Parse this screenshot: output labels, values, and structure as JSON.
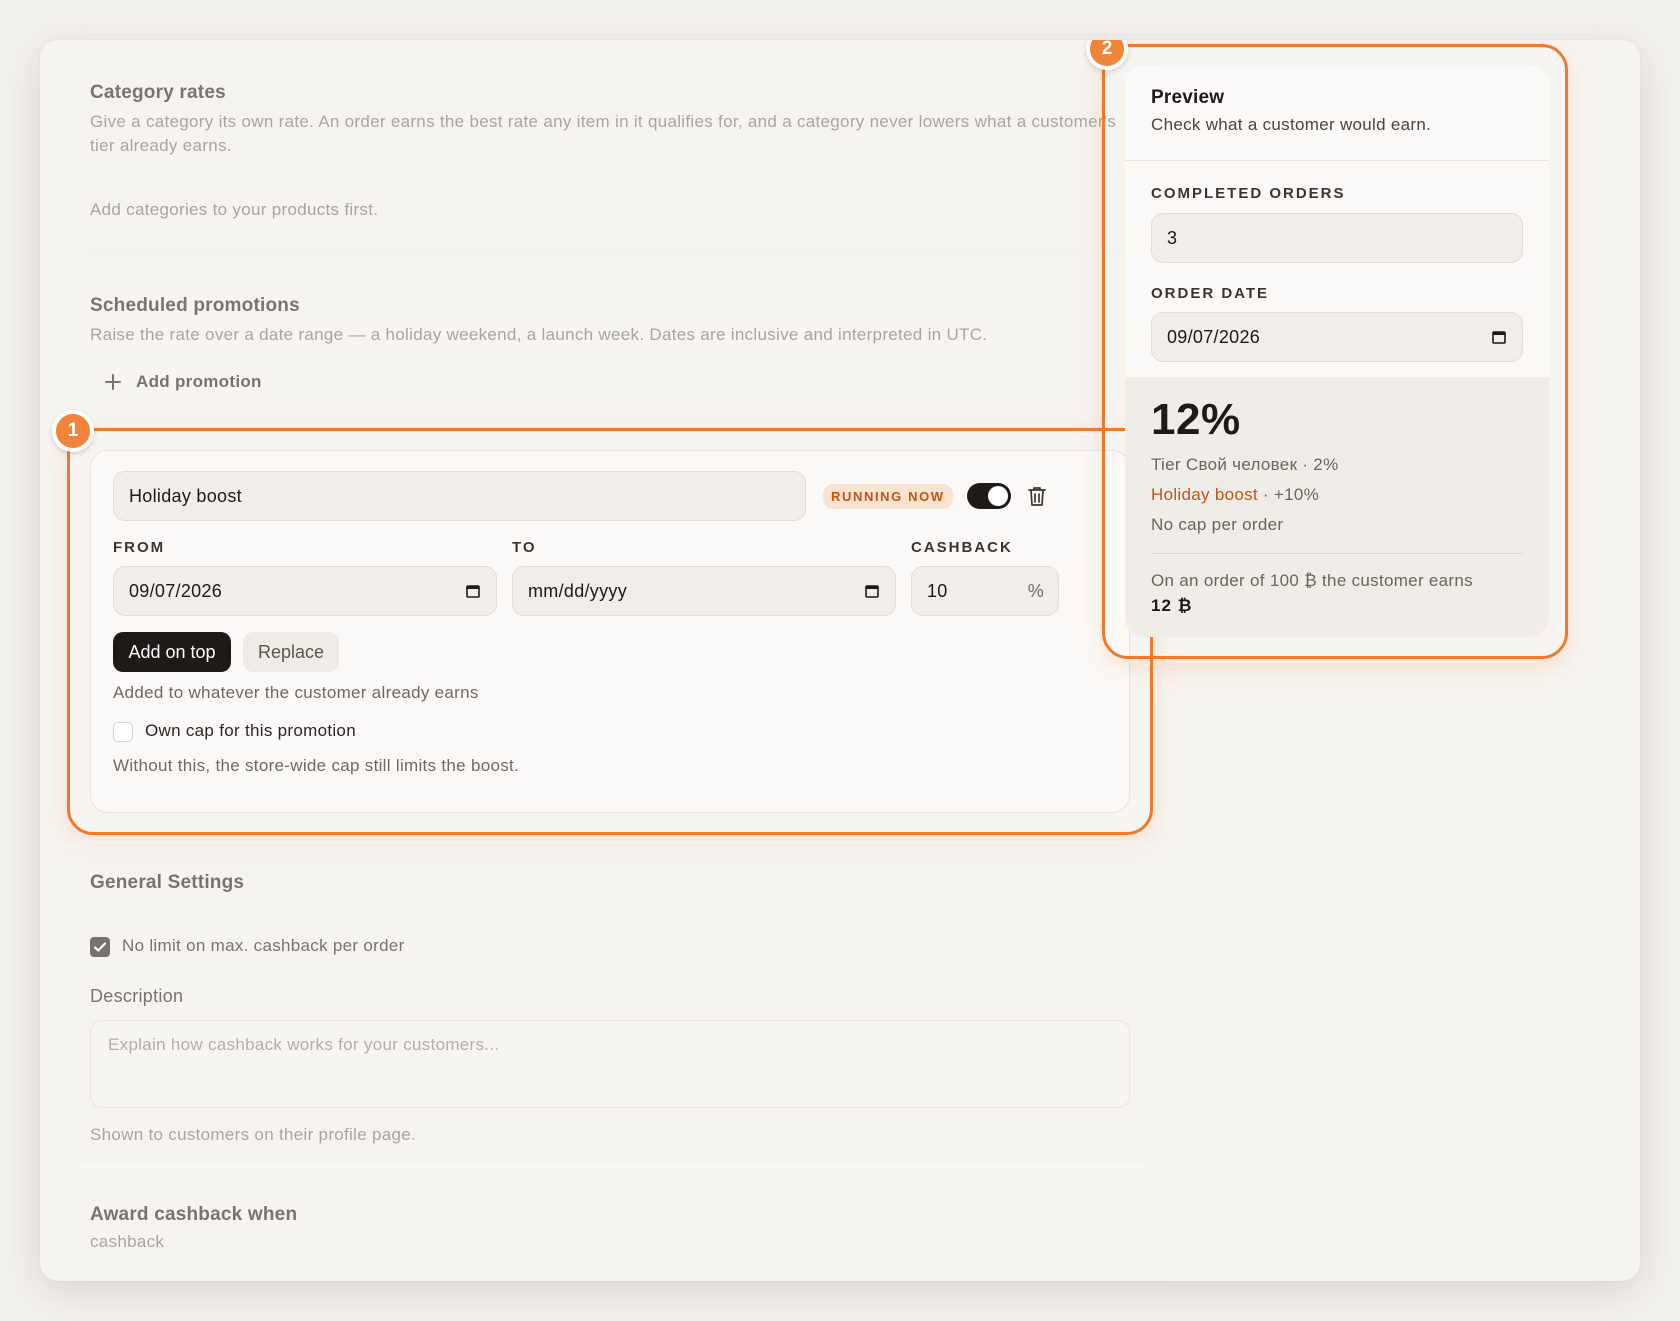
{
  "category_rates": {
    "title": "Category rates",
    "description": "Give a category its own rate. An order earns the best rate any item in it qualifies for, and a category never lowers what a customer's tier already earns.",
    "empty_note": "Add categories to your products first."
  },
  "scheduled_promotions": {
    "title": "Scheduled promotions",
    "description": "Raise the rate over a date range — a holiday weekend, a launch week. Dates are inclusive and interpreted in UTC.",
    "add_label": "Add promotion",
    "badge": "1"
  },
  "promotion": {
    "name": "Holiday boost",
    "status": "RUNNING NOW",
    "enabled": true,
    "from_label": "FROM",
    "from_value": "09/07/2026",
    "to_label": "TO",
    "to_value": "mm/dd/yyyy",
    "cashback_label": "CASHBACK",
    "cashback_value": "10",
    "cashback_unit": "%",
    "mode_active": "Add on top",
    "mode_other": "Replace",
    "mode_hint": "Added to whatever the customer already earns",
    "own_cap_label": "Own cap for this promotion",
    "own_cap_checked": false,
    "cap_hint": "Without this, the store-wide cap still limits the boost."
  },
  "general_settings": {
    "title": "General Settings",
    "no_limit_label": "No limit on max. cashback per order",
    "no_limit_checked": true,
    "description_label": "Description",
    "description_placeholder": "Explain how cashback works for your customers...",
    "description_hint": "Shown to customers on their profile page."
  },
  "award": {
    "title": "Award cashback when",
    "value": "cashback"
  },
  "preview": {
    "badge": "2",
    "title": "Preview",
    "subtitle": "Check what a customer would earn.",
    "orders_label": "COMPLETED ORDERS",
    "orders_value": "3",
    "date_label": "ORDER DATE",
    "date_value": "09/07/2026",
    "rate": "12%",
    "tier_line": "Tier Свой человек · 2%",
    "promo_name": "Holiday boost",
    "promo_boost": " · +10%",
    "cap_line": "No cap per order",
    "earn_line": "On an order of 100 ₿ the customer earns",
    "earn_value": "12 ₿"
  },
  "colors": {
    "accent": "#ef7a2e",
    "status_text": "#c45412",
    "status_bg": "#fbe3d2",
    "dark": "#1d1a17"
  },
  "icons": [
    "plus-icon",
    "trash-icon",
    "calendar-icon",
    "check-icon"
  ]
}
